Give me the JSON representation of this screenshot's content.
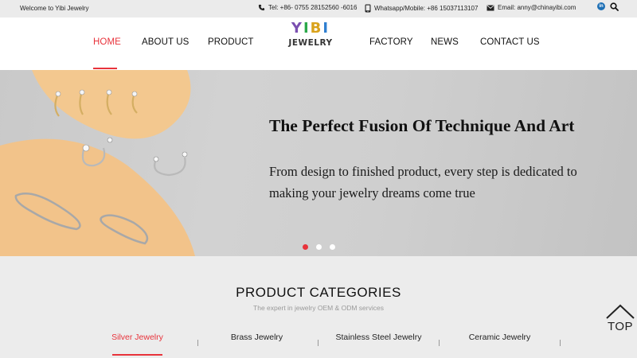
{
  "topbar": {
    "welcome": "Welcome to Yibi Jewelry",
    "tel": "Tel: +86- 0755 28152560 -6016",
    "whatsapp": "Whatsapp/Mobile: +86 15037113107",
    "email": "Email: anny@chinayibi.com",
    "linkedin_label": "in"
  },
  "logo": {
    "yibi_letters": [
      "Y",
      "I",
      "B",
      "I"
    ],
    "yibi_colors": [
      "#7a4fb0",
      "#2ba84a",
      "#d9a21b",
      "#2f7fd0"
    ],
    "jewelry": "JEWELRY"
  },
  "nav": {
    "home": "HOME",
    "about": "ABOUT US",
    "product": "PRODUCT",
    "factory": "FACTORY",
    "news": "NEWS",
    "contact": "CONTACT US"
  },
  "banner": {
    "headline": "The Perfect Fusion Of Technique And Art",
    "subtext": "From design to finished product, every step is dedicated to making your jewelry dreams come true",
    "slide_count": 3,
    "active_slide": 1
  },
  "categories": {
    "title": "PRODUCT CATEGORIES",
    "subtitle": "The expert in jewelry OEM & ODM services",
    "tabs": [
      "Silver Jewelry",
      "Brass Jewelry",
      "Stainless Steel Jewelry",
      "Ceramic Jewelry"
    ],
    "active_tab": 0
  },
  "back_to_top": "TOP",
  "colors": {
    "accent": "#e8333b",
    "banner_orange": "#f2c38a"
  }
}
